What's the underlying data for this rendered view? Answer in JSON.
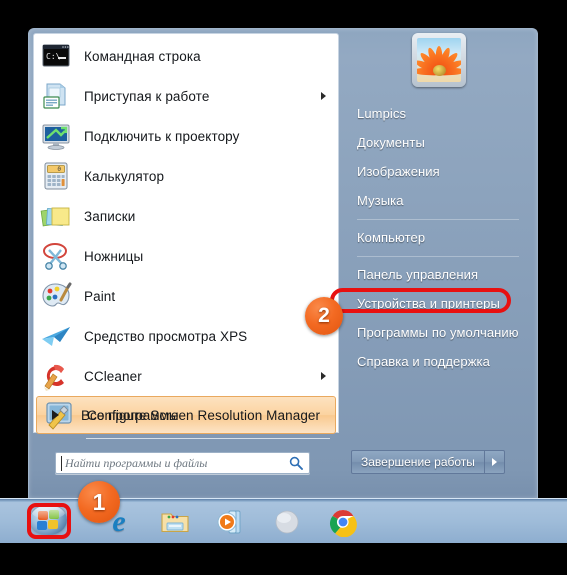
{
  "os": "Windows 7",
  "colors": {
    "accent_orange": "#f36a22",
    "annotation_red": "#e81010",
    "highlight_fill": "#fbd3a0",
    "menu_text_light": "#ffffff",
    "menu_text_dark": "#15181c"
  },
  "start_menu": {
    "programs": [
      {
        "label": "Командная строка",
        "icon": "command-prompt-icon",
        "has_submenu": false,
        "highlighted": false
      },
      {
        "label": "Приступая к работе",
        "icon": "getting-started-icon",
        "has_submenu": true,
        "highlighted": false
      },
      {
        "label": "Подключить к проектору",
        "icon": "connect-to-projector-icon",
        "has_submenu": false,
        "highlighted": false
      },
      {
        "label": "Калькулятор",
        "icon": "calculator-icon",
        "has_submenu": false,
        "highlighted": false
      },
      {
        "label": "Записки",
        "icon": "sticky-notes-icon",
        "has_submenu": false,
        "highlighted": false
      },
      {
        "label": "Ножницы",
        "icon": "snipping-tool-icon",
        "has_submenu": false,
        "highlighted": false
      },
      {
        "label": "Paint",
        "icon": "paint-icon",
        "has_submenu": false,
        "highlighted": false
      },
      {
        "label": "Средство просмотра XPS",
        "icon": "xps-viewer-icon",
        "has_submenu": false,
        "highlighted": false
      },
      {
        "label": "CCleaner",
        "icon": "ccleaner-icon",
        "has_submenu": true,
        "highlighted": false
      },
      {
        "label": "Configure Screen Resolution Manager",
        "icon": "screen-resolution-manager-icon",
        "has_submenu": false,
        "highlighted": true
      }
    ],
    "all_programs": {
      "label": "Все программы",
      "icon": "right-arrow-icon"
    },
    "user": {
      "name": "Lumpics",
      "avatar": "orange-flower-avatar"
    },
    "right_items": [
      {
        "label": "Lumpics",
        "separator_after": false
      },
      {
        "label": "Документы",
        "separator_after": false
      },
      {
        "label": "Изображения",
        "separator_after": false
      },
      {
        "label": "Музыка",
        "separator_after": true
      },
      {
        "label": "Компьютер",
        "separator_after": true
      },
      {
        "label": "Панель управления",
        "separator_after": false
      },
      {
        "label": "Устройства и принтеры",
        "separator_after": false
      },
      {
        "label": "Программы по умолчанию",
        "separator_after": false
      },
      {
        "label": "Справка и поддержка",
        "separator_after": false
      }
    ],
    "search": {
      "placeholder": "Найти программы и файлы",
      "value": "",
      "icon": "search-icon"
    },
    "shutdown": {
      "label": "Завершение работы",
      "arrow_icon": "chevron-right-icon"
    }
  },
  "taskbar": {
    "start_button": {
      "name": "Пуск",
      "icon": "windows-start-orb-icon"
    },
    "pinned": [
      {
        "icon": "internet-explorer-icon"
      },
      {
        "icon": "windows-explorer-icon"
      },
      {
        "icon": "windows-media-player-icon"
      },
      {
        "icon": "globe-icon"
      },
      {
        "icon": "google-chrome-icon"
      }
    ]
  },
  "annotations": [
    {
      "id": "marker-1",
      "number": "1",
      "targets": "start-button"
    },
    {
      "id": "marker-2",
      "number": "2",
      "targets": "control-panel-item"
    }
  ]
}
